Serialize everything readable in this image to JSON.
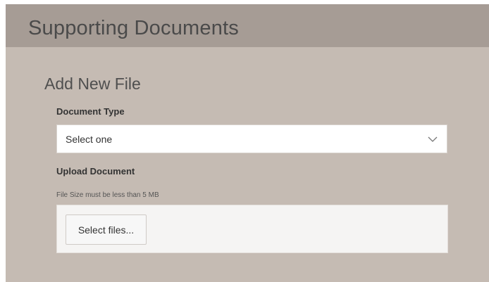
{
  "header": {
    "title": "Supporting Documents"
  },
  "form": {
    "section_title": "Add New File",
    "document_type": {
      "label": "Document Type",
      "selected_value": "Select one",
      "icon": "chevron-down-icon"
    },
    "upload": {
      "label": "Upload Document",
      "size_hint": "File Size must be less than 5 MB",
      "button_label": "Select files..."
    }
  },
  "colors": {
    "header_bg": "#a69c95",
    "panel_bg": "#c5bbb3",
    "upload_zone_bg": "#f5f4f3"
  }
}
